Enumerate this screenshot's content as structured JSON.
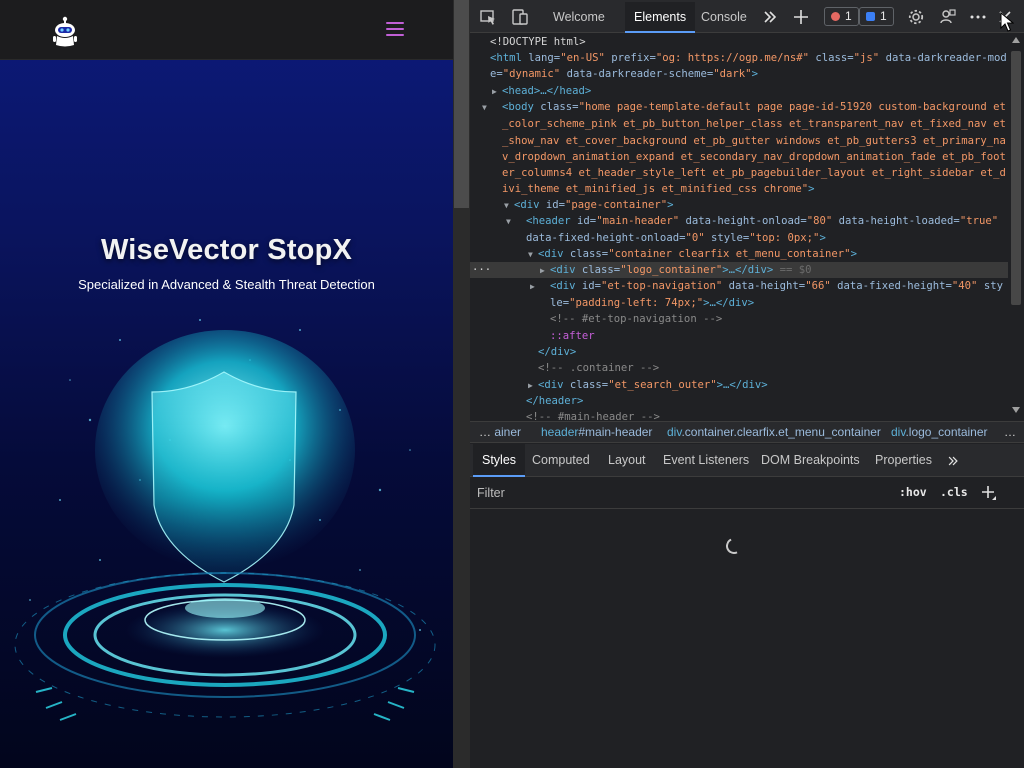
{
  "site": {
    "hero_title": "WiseVector StopX",
    "hero_subtitle": "Specialized in Advanced & Stealth Threat Detection",
    "colors": {
      "header_bg": "#1c1c1e",
      "menu_accent": "#c15fd6",
      "glow": "#22e6f0"
    },
    "icons": {
      "logo": "robot-logo-icon",
      "menu": "hamburger-menu-icon"
    }
  },
  "devtools": {
    "tabs": [
      {
        "label": "Welcome"
      },
      {
        "label": "Elements"
      },
      {
        "label": "Console"
      }
    ],
    "active_tab": "Elements",
    "errors_count": "1",
    "issues_count": "1",
    "dom_lines": {
      "doctype": "<!DOCTYPE html>",
      "html_lang": "lang",
      "html_lang_val": "\"en-US\"",
      "html_prefix": "prefix",
      "html_prefix_val": "\"og: https://ogp.me/ns#\"",
      "html_class": "class",
      "html_class_val": "\"js\"",
      "html_dr_mode": "data-darkreader-mode",
      "html_dr_mode_val": "\"dynamic\"",
      "html_dr_scheme": "data-darkreader-scheme",
      "html_dr_scheme_val": "\"dark\"",
      "head": "<head>…</head>",
      "body_class_val": "\"home page-template-default page page-id-51920 custom-background et_color_scheme_pink et_pb_button_helper_class et_transparent_nav et_fixed_nav et_show_nav et_cover_background et_pb_gutter windows et_pb_gutters3 et_primary_nav_dropdown_animation_expand et_secondary_nav_dropdown_animation_fade et_pb_footer_columns4 et_header_style_left et_pb_pagebuilder_layout et_right_sidebar et_divi_theme et_minified_js et_minified_css chrome\"",
      "page_container_val": "\"page-container\"",
      "header_id_val": "\"main-header\"",
      "header_h_onload": "data-height-onload",
      "header_h_onload_val": "\"80\"",
      "header_h_loaded": "data-height-loaded",
      "header_h_loaded_val": "\"true\"",
      "header_fixed_onload": "data-fixed-height-onload",
      "header_fixed_onload_val": "\"0\"",
      "header_style_val": "\"top: 0px;\"",
      "container_class_val": "\"container clearfix et_menu_container\"",
      "logo_class_val": "\"logo_container\"",
      "logo_tail": "== $0",
      "topnav_id_val": "\"et-top-navigation\"",
      "topnav_h": "data-height",
      "topnav_h_val": "\"66\"",
      "topnav_fh": "data-fixed-height",
      "topnav_fh_val": "\"40\"",
      "topnav_style_val": "\"padding-left: 74px;\"",
      "comment_topnav": "<!-- #et-top-navigation -->",
      "after": "::after",
      "div_close": "</div>",
      "comment_container": "<!-- .container -->",
      "search_class_val": "\"et_search_outer\"",
      "header_close": "</header>",
      "comment_main_header": "<!-- #main-header -->"
    },
    "breadcrumbs": [
      {
        "tag": "…",
        "text": "ainer"
      },
      {
        "tag": "header",
        "text": "#main-header"
      },
      {
        "tag": "div",
        "text": ".container.clearfix.et_menu_container"
      },
      {
        "tag": "div",
        "text": ".logo_container"
      }
    ],
    "sub_tabs": [
      "Styles",
      "Computed",
      "Layout",
      "Event Listeners",
      "DOM Breakpoints",
      "Properties"
    ],
    "filter_placeholder": "Filter",
    "hov_label": ":hov",
    "cls_label": ".cls",
    "colors": {
      "toolbar_bg": "#292a2d",
      "panel_bg": "#202124",
      "tag": "#5db0d7",
      "attr": "#9bbbdc",
      "value": "#f29766",
      "accent": "#5b9cf6",
      "error": "#e46962",
      "issue": "#3b7ff5"
    }
  }
}
